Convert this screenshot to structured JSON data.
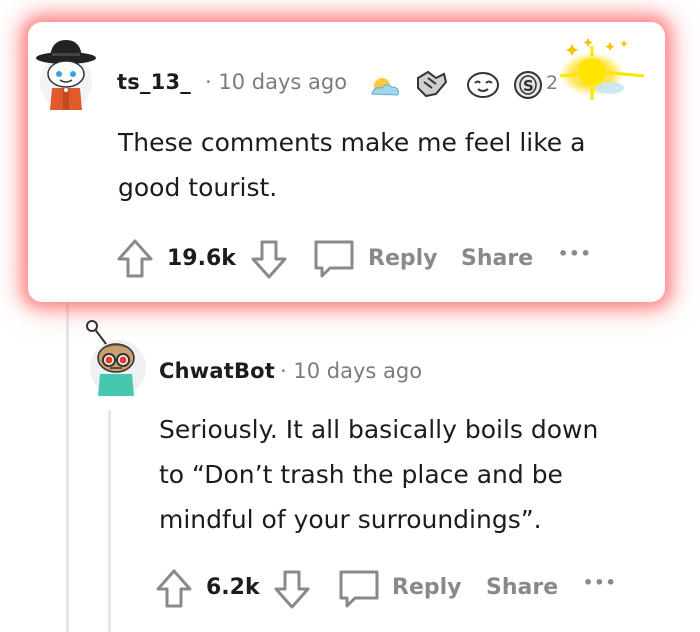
{
  "comments": [
    {
      "username": "ts_13_",
      "meta": "· 10 days ago",
      "award_count": "2",
      "body_lines": [
        "These comments make me feel like a",
        "good tourist."
      ],
      "votes": "19.6k",
      "reply_label": "Reply",
      "share_label": "Share",
      "more_label": "•••"
    },
    {
      "username": "ChwatBot",
      "meta": "· 10 days ago",
      "body_lines": [
        "Seriously. It all basically boils down",
        "to “Don’t trash the place and be",
        "mindful of your surroundings”."
      ],
      "votes": "6.2k",
      "reply_label": "Reply",
      "share_label": "Share",
      "more_label": "•••"
    }
  ],
  "colors": {
    "highlight_glow": "#ff5050",
    "text": "#1c1c1c",
    "muted": "#878a8c",
    "thread_line": "#e6e8ea"
  }
}
